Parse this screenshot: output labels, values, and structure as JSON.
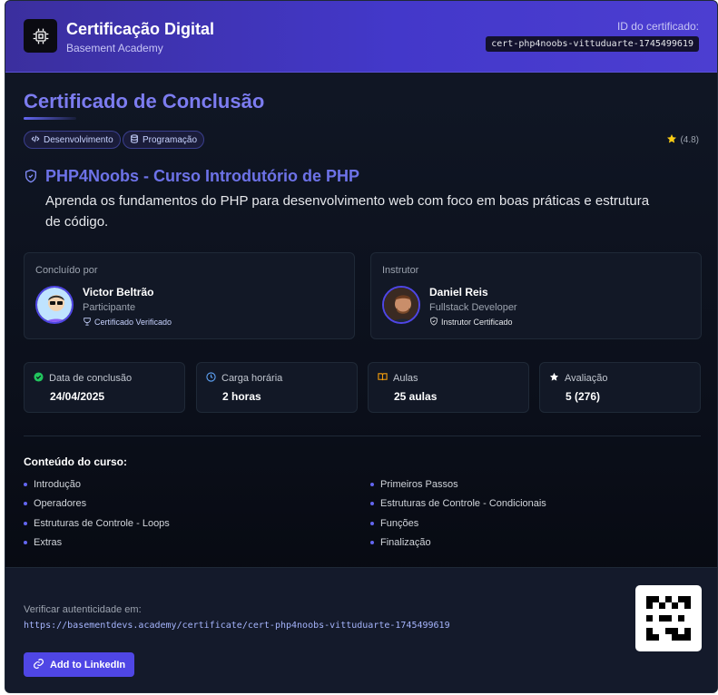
{
  "header": {
    "title": "Certificação Digital",
    "subtitle": "Basement Academy",
    "id_label": "ID do certificado:",
    "id_value": "cert-php4noobs-vittuduarte-1745499619"
  },
  "main": {
    "title": "Certificado de Conclusão",
    "tags": [
      "Desenvolvimento",
      "Programação"
    ],
    "rating": "(4.8)",
    "course_title": "PHP4Noobs - Curso Introdutório de PHP",
    "course_description": "Aprenda os fundamentos do PHP para desenvolvimento web com foco em boas práticas e estrutura de código."
  },
  "people": {
    "student": {
      "label": "Concluído por",
      "name": "Victor Beltrão",
      "role": "Participante",
      "badge": "Certificado Verificado"
    },
    "instructor": {
      "label": "Instrutor",
      "name": "Daniel Reis",
      "role": "Fullstack Developer",
      "badge": "Instrutor Certificado"
    }
  },
  "stats": [
    {
      "label": "Data de conclusão",
      "value": "24/04/2025",
      "icon": "check-circle-icon",
      "color": "#22c55e"
    },
    {
      "label": "Carga horária",
      "value": "2 horas",
      "icon": "clock-icon",
      "color": "#60a5fa"
    },
    {
      "label": "Aulas",
      "value": "25 aulas",
      "icon": "book-icon",
      "color": "#f59e0b"
    },
    {
      "label": "Avaliação",
      "value": "5 (276)",
      "icon": "star-icon",
      "color": "#ffffff"
    }
  ],
  "content": {
    "title": "Conteúdo do curso:",
    "modules": [
      "Introdução",
      "Primeiros Passos",
      "Operadores",
      "Estruturas de Controle - Condicionais",
      "Estruturas de Controle - Loops",
      "Funções",
      "Extras",
      "Finalização"
    ]
  },
  "footer": {
    "verify_label": "Verificar autenticidade em:",
    "verify_url": "https://basementdevs.academy/certificate/cert-php4noobs-vittuduarte-1745499619",
    "linkedin_label": "Add to LinkedIn"
  },
  "colors": {
    "accent": "#4f46e5",
    "header_gradient_start": "#3b2f9e",
    "header_gradient_end": "#4c3ed1"
  }
}
